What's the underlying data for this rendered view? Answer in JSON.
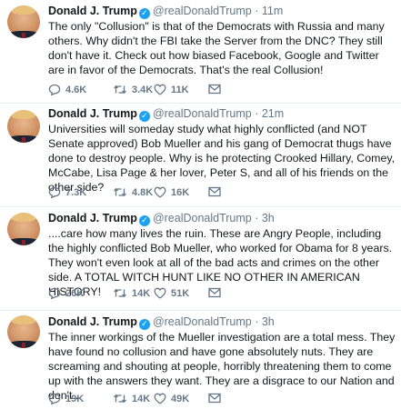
{
  "tweets": [
    {
      "name": "Donald J. Trump",
      "handle": "@realDonaldTrump",
      "time": "· 11m",
      "text": "The only \"Collusion\" is that of the Democrats with Russia and many others. Why didn't the FBI take the Server from the DNC? They still don't have it. Check out how biased Facebook, Google and Twitter are in favor of the Democrats. That's the real Collusion!",
      "replies": "4.6K",
      "retweets": "3.4K",
      "likes": "11K"
    },
    {
      "name": "Donald J. Trump",
      "handle": "@realDonaldTrump",
      "time": "· 21m",
      "text": "Universities will someday study what highly conflicted (and NOT Senate approved) Bob Mueller and his gang of Democrat thugs have done to destroy people. Why is he protecting Crooked Hillary, Comey, McCabe, Lisa Page & her lover, Peter S, and all of his friends on the other side?",
      "replies": "7.3K",
      "retweets": "4.8K",
      "likes": "16K"
    },
    {
      "name": "Donald J. Trump",
      "handle": "@realDonaldTrump",
      "time": "· 3h",
      "text": "....care how many lives the ruin. These are Angry People, including the highly conflicted Bob Mueller, who worked for Obama for 8 years. They won't even look at all of the bad acts and crimes on the other side. A TOTAL WITCH HUNT LIKE NO OTHER IN AMERICAN HISTORY!",
      "replies": "26K",
      "retweets": "14K",
      "likes": "51K"
    },
    {
      "name": "Donald J. Trump",
      "handle": "@realDonaldTrump",
      "time": "· 3h",
      "text": "The inner workings of the Mueller investigation are a total mess. They have found no collusion and have gone absolutely nuts. They are screaming and shouting at people, horribly threatening them to come up with the answers they want. They are a disgrace to our Nation and don't...",
      "replies": "19K",
      "retweets": "14K",
      "likes": "49K"
    }
  ],
  "icons": {
    "verified": "verified-badge-icon",
    "reply": "reply-icon",
    "retweet": "retweet-icon",
    "like": "heart-icon",
    "message": "envelope-icon"
  },
  "colors": {
    "verified": "#1da1f2",
    "muted": "#657786",
    "text": "#14171a"
  }
}
